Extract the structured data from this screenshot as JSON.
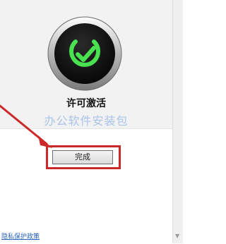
{
  "dialog": {
    "title": "许可激活",
    "watermark": "办公软件安装包",
    "done_button": "完成",
    "privacy_link": "隐私保护政策"
  },
  "icons": {
    "status": "checkmark-badge-icon",
    "annotation": "red-arrow",
    "scroll": "scroll-down-icon"
  },
  "colors": {
    "annotation_red": "#cc2a2a",
    "check_green": "#49e14f",
    "badge_dark": "#0c0c0c",
    "link_blue": "#2a62b7"
  }
}
